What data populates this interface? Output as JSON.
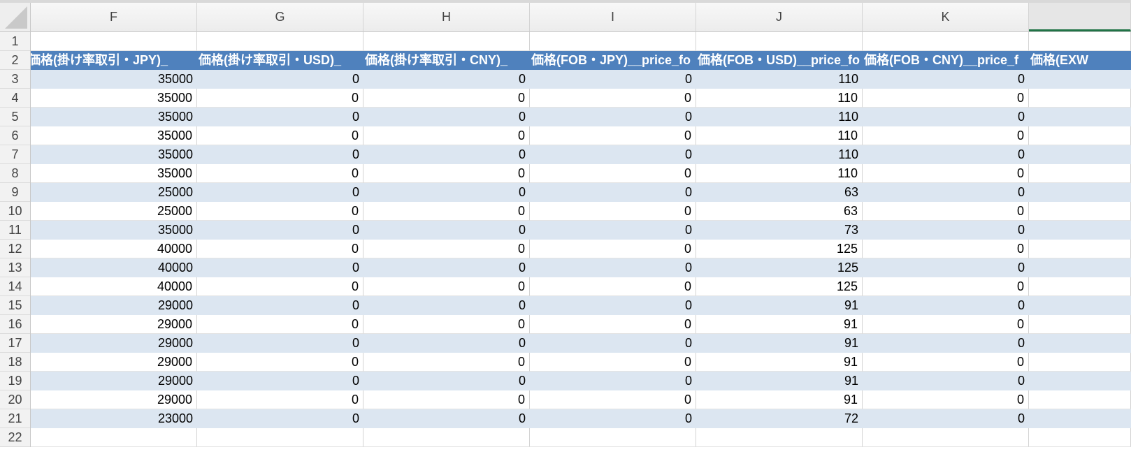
{
  "columns": [
    "F",
    "G",
    "H",
    "I",
    "J",
    "K",
    ""
  ],
  "header_row": [
    "価格(掛け率取引・JPY)_",
    "価格(掛け率取引・USD)_",
    "価格(掛け率取引・CNY)_",
    "価格(FOB・JPY)__price_fo",
    "価格(FOB・USD)__price_fo",
    "価格(FOB・CNY)__price_f",
    "価格(EXW"
  ],
  "row_numbers": [
    "1",
    "2",
    "3",
    "4",
    "5",
    "6",
    "7",
    "8",
    "9",
    "10",
    "11",
    "12",
    "13",
    "14",
    "15",
    "16",
    "17",
    "18",
    "19",
    "20",
    "21",
    "22"
  ],
  "rows": [
    [
      "35000",
      "0",
      "0",
      "0",
      "110",
      "0",
      ""
    ],
    [
      "35000",
      "0",
      "0",
      "0",
      "110",
      "0",
      ""
    ],
    [
      "35000",
      "0",
      "0",
      "0",
      "110",
      "0",
      ""
    ],
    [
      "35000",
      "0",
      "0",
      "0",
      "110",
      "0",
      ""
    ],
    [
      "35000",
      "0",
      "0",
      "0",
      "110",
      "0",
      ""
    ],
    [
      "35000",
      "0",
      "0",
      "0",
      "110",
      "0",
      ""
    ],
    [
      "25000",
      "0",
      "0",
      "0",
      "63",
      "0",
      ""
    ],
    [
      "25000",
      "0",
      "0",
      "0",
      "63",
      "0",
      ""
    ],
    [
      "35000",
      "0",
      "0",
      "0",
      "73",
      "0",
      ""
    ],
    [
      "40000",
      "0",
      "0",
      "0",
      "125",
      "0",
      ""
    ],
    [
      "40000",
      "0",
      "0",
      "0",
      "125",
      "0",
      ""
    ],
    [
      "40000",
      "0",
      "0",
      "0",
      "125",
      "0",
      ""
    ],
    [
      "29000",
      "0",
      "0",
      "0",
      "91",
      "0",
      ""
    ],
    [
      "29000",
      "0",
      "0",
      "0",
      "91",
      "0",
      ""
    ],
    [
      "29000",
      "0",
      "0",
      "0",
      "91",
      "0",
      ""
    ],
    [
      "29000",
      "0",
      "0",
      "0",
      "91",
      "0",
      ""
    ],
    [
      "29000",
      "0",
      "0",
      "0",
      "91",
      "0",
      ""
    ],
    [
      "29000",
      "0",
      "0",
      "0",
      "91",
      "0",
      ""
    ],
    [
      "23000",
      "0",
      "0",
      "0",
      "72",
      "0",
      ""
    ]
  ],
  "colors": {
    "header_fill": "#4f81bd",
    "band_fill": "#dce6f1",
    "selected_column_accent": "#217346"
  }
}
